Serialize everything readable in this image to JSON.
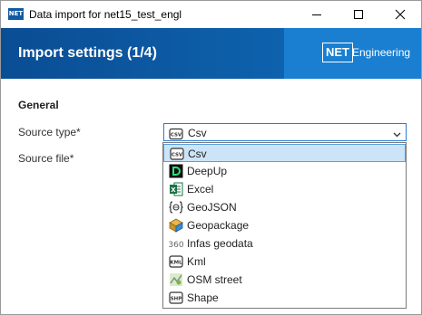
{
  "window": {
    "title": "Data import for net15_test_engl",
    "app_icon_text": "NET"
  },
  "header": {
    "title": "Import settings (1/4)",
    "brand_logo": "NET",
    "brand_text": "Engineering",
    "colors": {
      "band": "#0d5ea8",
      "brand_panel": "#1a7fd1"
    }
  },
  "form": {
    "section": "General",
    "source_type_label": "Source type*",
    "source_file_label": "Source file*",
    "source_type_value": "Csv",
    "source_type_icon": "csv-file-icon"
  },
  "dropdown": {
    "selected": "Csv",
    "options": [
      {
        "label": "Csv",
        "icon": "csv-file-icon"
      },
      {
        "label": "DeepUp",
        "icon": "deepup-icon"
      },
      {
        "label": "Excel",
        "icon": "excel-icon"
      },
      {
        "label": "GeoJSON",
        "icon": "geojson-icon"
      },
      {
        "label": "Geopackage",
        "icon": "geopackage-icon"
      },
      {
        "label": "Infas geodata",
        "icon": "infas-360-icon"
      },
      {
        "label": "Kml",
        "icon": "kml-file-icon"
      },
      {
        "label": "OSM street",
        "icon": "osm-map-icon"
      },
      {
        "label": "Shape",
        "icon": "shape-file-icon"
      }
    ]
  }
}
